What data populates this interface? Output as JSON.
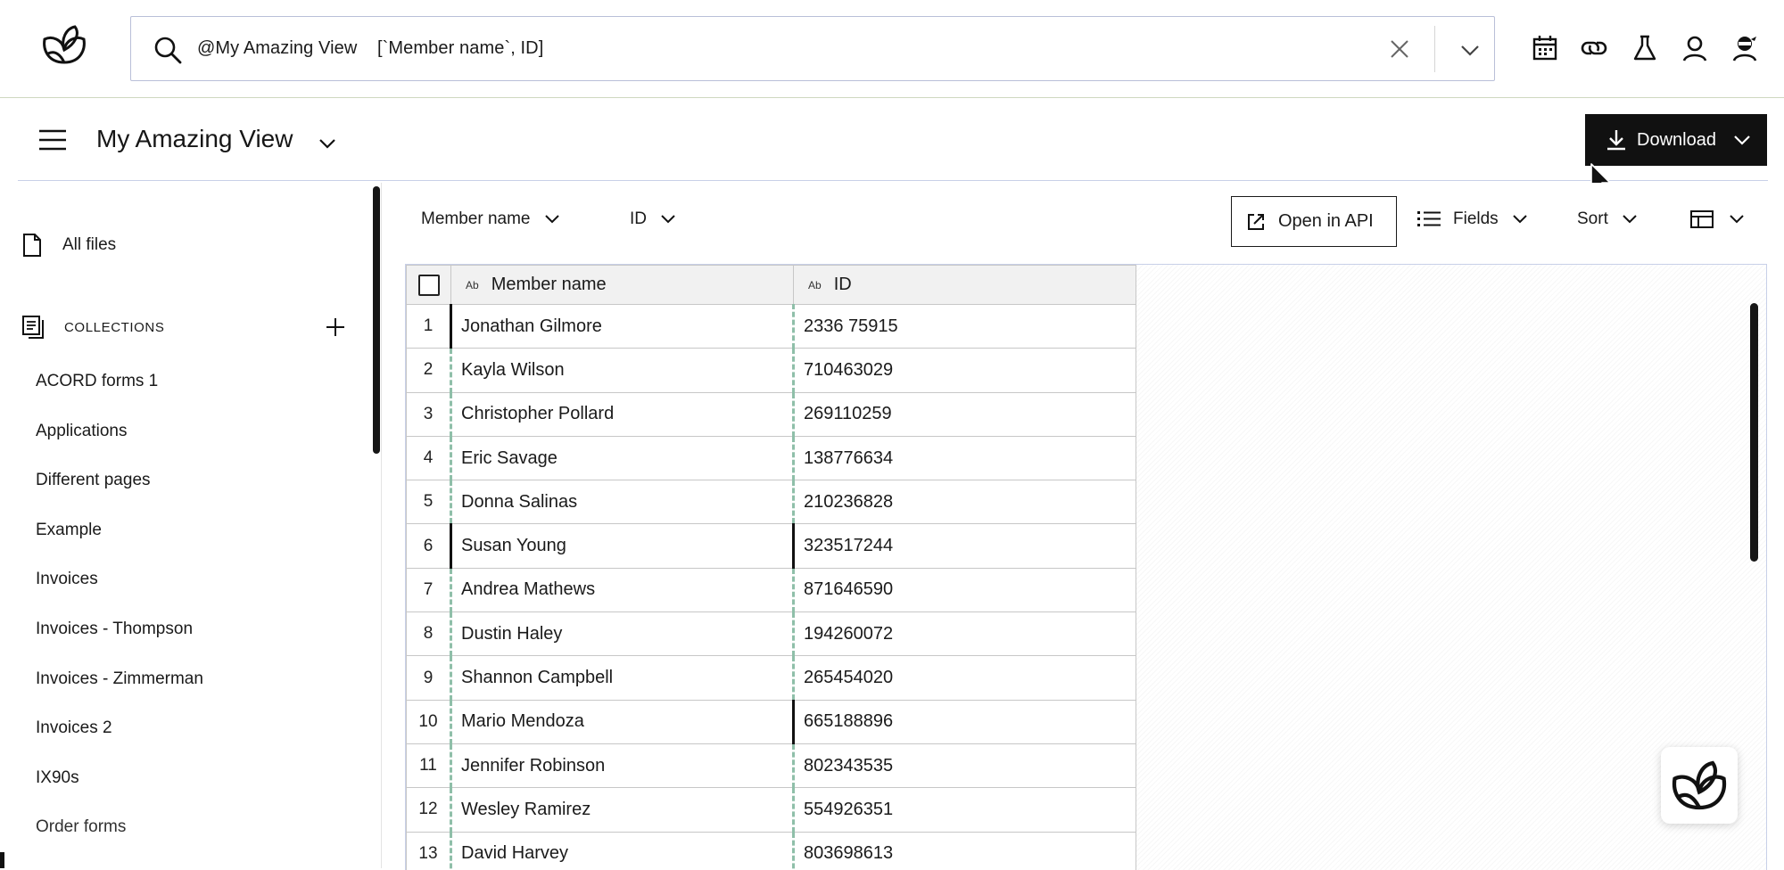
{
  "search": {
    "query": "@My Amazing View    [`Member name`, ID]"
  },
  "header": {
    "title": "My Amazing View",
    "download_label": "Download"
  },
  "sidebar": {
    "all_files": "All files",
    "collections_label": "COLLECTIONS",
    "collections": [
      "ACORD forms 1",
      "Applications",
      "Different pages",
      "Example",
      "Invoices",
      "Invoices - Thompson",
      "Invoices - Zimmerman",
      "Invoices 2",
      "IX90s",
      "Order forms"
    ]
  },
  "toolbar": {
    "filter_member": "Member name",
    "filter_id": "ID",
    "open_api": "Open in API",
    "fields": "Fields",
    "sort": "Sort"
  },
  "table": {
    "columns": [
      {
        "type": "Ab",
        "label": "Member name"
      },
      {
        "type": "Ab",
        "label": "ID"
      }
    ],
    "rows": [
      {
        "n": "1",
        "name": "Jonathan Gilmore",
        "id": "2336 75915"
      },
      {
        "n": "2",
        "name": "Kayla Wilson",
        "id": "710463029"
      },
      {
        "n": "3",
        "name": "Christopher Pollard",
        "id": "269110259"
      },
      {
        "n": "4",
        "name": "Eric Savage",
        "id": "138776634"
      },
      {
        "n": "5",
        "name": "Donna Salinas",
        "id": "210236828"
      },
      {
        "n": "6",
        "name": "Susan Young",
        "id": "323517244"
      },
      {
        "n": "7",
        "name": "Andrea Mathews",
        "id": "871646590"
      },
      {
        "n": "8",
        "name": "Dustin Haley",
        "id": "194260072"
      },
      {
        "n": "9",
        "name": "Shannon Campbell",
        "id": "265454020"
      },
      {
        "n": "10",
        "name": "Mario Mendoza",
        "id": "665188896"
      },
      {
        "n": "11",
        "name": "Jennifer Robinson",
        "id": "802343535"
      },
      {
        "n": "12",
        "name": "Wesley Ramirez",
        "id": "554926351"
      },
      {
        "n": "13",
        "name": "David Harvey",
        "id": "803698613"
      }
    ]
  },
  "icons": {
    "logo": "logo-icon",
    "search": "search-icon",
    "clear": "close-icon",
    "calendar": "calendar-icon",
    "link": "link-icon",
    "lab": "flask-icon",
    "user": "user-icon",
    "ninja": "ninja-icon"
  }
}
